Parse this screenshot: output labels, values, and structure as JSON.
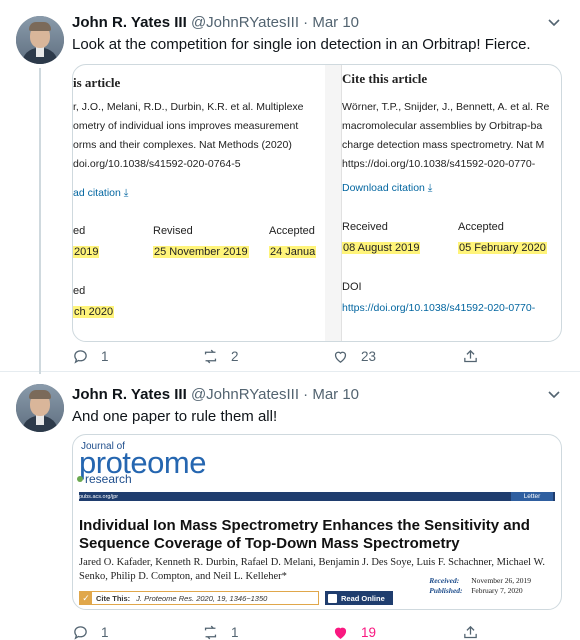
{
  "tweets": [
    {
      "author": {
        "name": "John R. Yates III",
        "handle": "@JohnRYatesIII"
      },
      "separator": "·",
      "date": "Mar 10",
      "text": "Look at the competition for single ion detection in an Orbitrap! Fierce.",
      "embed": {
        "left": {
          "title": "is article",
          "lines": [
            "r, J.O., Melani, R.D., Durbin, K.R. et al. Multiplexe",
            "ometry of individual ions improves measurement",
            "orms and their complexes. Nat Methods (2020)",
            "doi.org/10.1038/s41592-020-0764-5"
          ],
          "download": "ad citation ⤓",
          "received_label": "ed",
          "received_date": "2019",
          "revised_label": "Revised",
          "revised_date": "25 November 2019",
          "accepted_label": "Accepted",
          "accepted_date": "24 Janua",
          "published_label": "ed",
          "published_date": "ch 2020"
        },
        "right": {
          "title": "Cite this article",
          "lines": [
            "Wörner, T.P., Snijder, J., Bennett, A. et al. Re",
            "macromolecular assemblies by Orbitrap-ba",
            "charge detection mass spectrometry. Nat M",
            "https://doi.org/10.1038/s41592-020-0770-"
          ],
          "download": "Download citation ⤓",
          "received_label": "Received",
          "received_date": "08 August 2019",
          "accepted_label": "Accepted",
          "accepted_date": "05 February 2020",
          "doi_label": "DOI",
          "doi_value": "https://doi.org/10.1038/s41592-020-0770-"
        }
      },
      "stats": {
        "replies": "1",
        "retweets": "2",
        "likes": "23"
      }
    },
    {
      "author": {
        "name": "John R. Yates III",
        "handle": "@JohnRYatesIII"
      },
      "separator": "·",
      "date": "Mar 10",
      "text": "And one paper to rule them all!",
      "embed": {
        "journal_small": "Journal of",
        "journal_big": "proteome",
        "journal_sub": "research",
        "url": "pubs.acs.org/jpr",
        "article_type": "Letter",
        "title": "Individual Ion Mass Spectrometry Enhances the Sensitivity and Sequence Coverage of Top-Down Mass Spectrometry",
        "authors": "Jared O. Kafader, Kenneth R. Durbin, Rafael D. Melani, Benjamin J. Des Soye, Luis F. Schachner, Michael W. Senko, Philip D. Compton, and Neil L. Kelleher*",
        "received_label": "Received:",
        "received_date": "November 26, 2019",
        "published_label": "Published:",
        "published_date": "February 7, 2020",
        "cite_label": "Cite This:",
        "cite_value": "J. Proteome Res. 2020, 19, 1346−1350",
        "read_online": "Read Online"
      },
      "stats": {
        "replies": "1",
        "retweets": "1",
        "likes": "19"
      }
    }
  ],
  "colors": {
    "like_active": "#f91880",
    "muted": "#536471",
    "highlight": "#fff47a",
    "link": "#0366a0"
  },
  "icons": [
    "reply-icon",
    "retweet-icon",
    "like-icon",
    "share-icon",
    "chevron-down-icon",
    "checkmark-icon",
    "read-online-icon"
  ]
}
